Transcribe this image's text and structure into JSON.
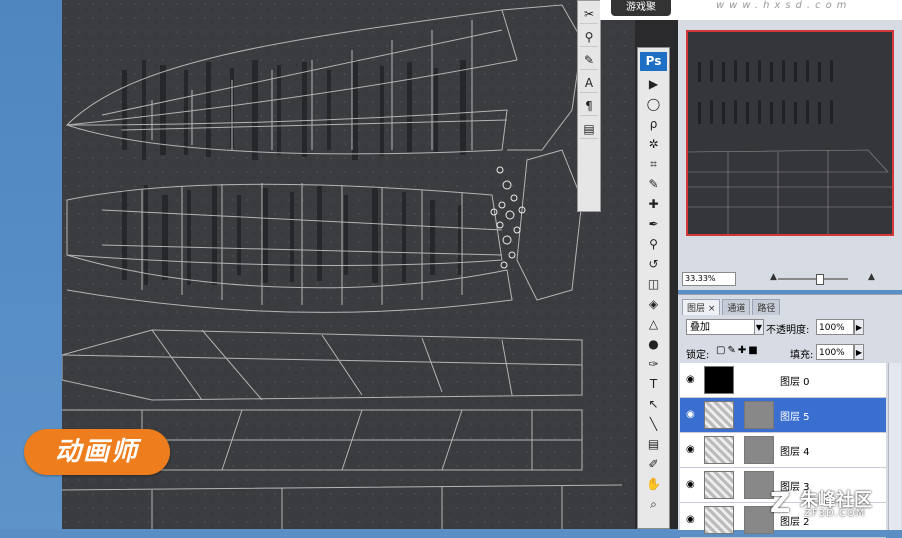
{
  "badge": {
    "text": "动画师"
  },
  "top_banner": {
    "tag": "游戏聚",
    "url": "www.hxsd.com"
  },
  "mini_toolbar": {
    "icons": [
      "scissors-icon",
      "stamp-icon",
      "brush-preset-icon",
      "character-icon",
      "paragraph-icon",
      "layer-comps-icon"
    ]
  },
  "toolbox": {
    "logo": "Ps",
    "tools": [
      {
        "name": "move-tool-icon",
        "glyph": "▶"
      },
      {
        "name": "marquee-tool-icon",
        "glyph": "◯"
      },
      {
        "name": "lasso-tool-icon",
        "glyph": "ρ"
      },
      {
        "name": "magic-wand-icon",
        "glyph": "✲"
      },
      {
        "name": "crop-tool-icon",
        "glyph": "⌗"
      },
      {
        "name": "eyedropper-icon",
        "glyph": "✎"
      },
      {
        "name": "healing-brush-icon",
        "glyph": "✚"
      },
      {
        "name": "brush-tool-icon",
        "glyph": "✒"
      },
      {
        "name": "clone-stamp-icon",
        "glyph": "⚲"
      },
      {
        "name": "history-brush-icon",
        "glyph": "↺"
      },
      {
        "name": "eraser-icon",
        "glyph": "◫"
      },
      {
        "name": "paint-bucket-icon",
        "glyph": "◈"
      },
      {
        "name": "blur-tool-icon",
        "glyph": "△"
      },
      {
        "name": "dodge-tool-icon",
        "glyph": "●"
      },
      {
        "name": "pen-tool-icon",
        "glyph": "✑"
      },
      {
        "name": "type-tool-icon",
        "glyph": "T"
      },
      {
        "name": "path-select-icon",
        "glyph": "↖"
      },
      {
        "name": "line-tool-icon",
        "glyph": "╲"
      },
      {
        "name": "notes-tool-icon",
        "glyph": "▤"
      },
      {
        "name": "eyedropper2-icon",
        "glyph": "✐"
      },
      {
        "name": "hand-tool-icon",
        "glyph": "✋"
      },
      {
        "name": "zoom-tool-icon",
        "glyph": "⌕"
      }
    ]
  },
  "navigator": {
    "zoom": "33.33%"
  },
  "layers_panel": {
    "tabs": [
      "图层 ×",
      "通道",
      "路径"
    ],
    "blend_mode": "叠加",
    "opacity_label": "不透明度:",
    "opacity": "100%",
    "lock_label": "锁定:",
    "fill_label": "填充:",
    "fill": "100%",
    "layers": [
      {
        "name": "图层 0",
        "thumb": "black",
        "mask": false,
        "selected": false
      },
      {
        "name": "图层 5",
        "thumb": "checker",
        "mask": true,
        "selected": true
      },
      {
        "name": "图层 4",
        "thumb": "checker",
        "mask": true,
        "selected": false
      },
      {
        "name": "图层 3",
        "thumb": "checker",
        "mask": true,
        "selected": false
      },
      {
        "name": "图层 2",
        "thumb": "checker",
        "mask": true,
        "selected": false
      }
    ]
  },
  "watermark": {
    "logo": "Z",
    "title": "朱峰社区",
    "url": "ZF3D.COM"
  }
}
